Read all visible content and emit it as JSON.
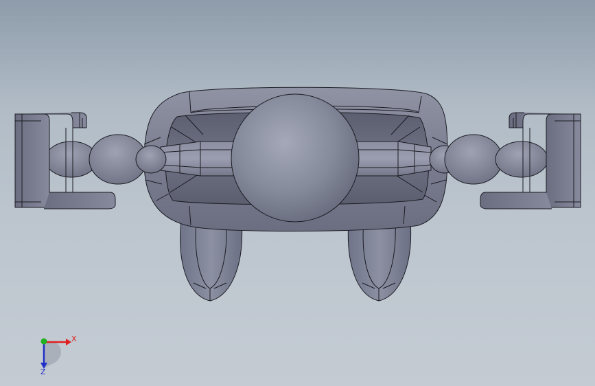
{
  "triad": {
    "x_label": "X",
    "z_label": "Z",
    "x_color": "#e02020",
    "y_color": "#20b020",
    "z_color": "#2030c8"
  },
  "model": {
    "shade_color": "#7d8091",
    "edge_color": "#1b1b22"
  }
}
